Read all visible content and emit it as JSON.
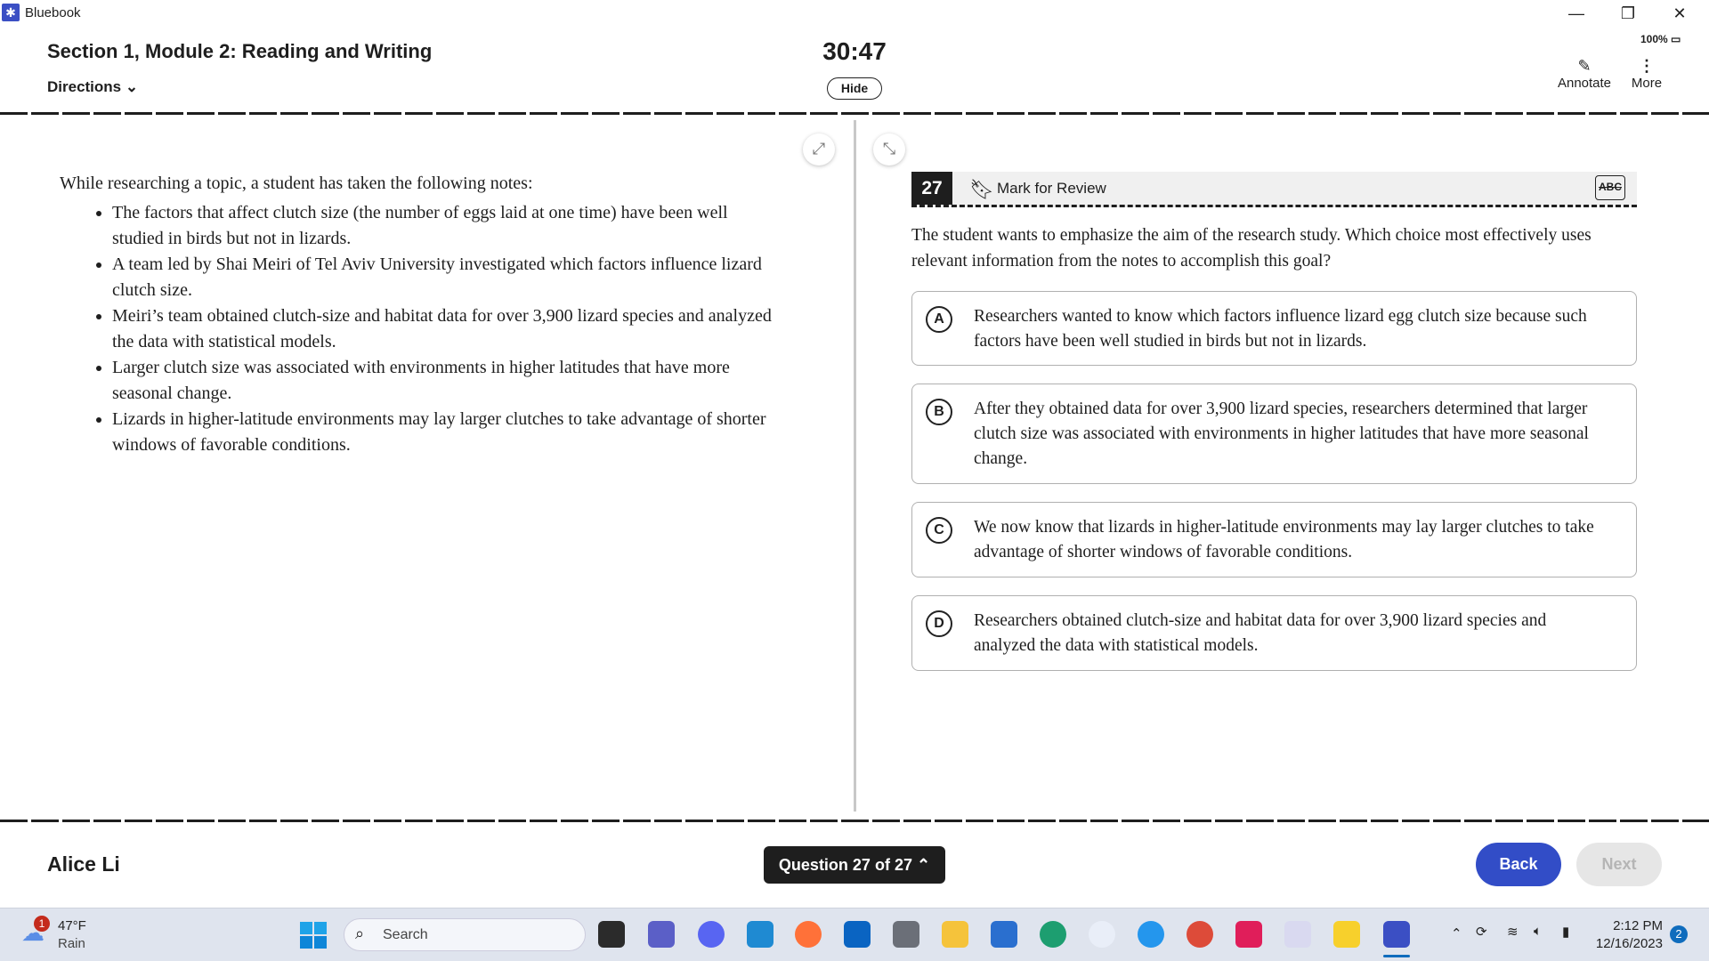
{
  "window": {
    "app_title": "Bluebook",
    "minimize": "—",
    "restore": "❐",
    "close": "✕"
  },
  "header": {
    "section_title": "Section 1, Module 2: Reading and Writing",
    "directions_label": "Directions",
    "timer": "30:47",
    "hide_label": "Hide",
    "battery": "100%",
    "annotate_label": "Annotate",
    "more_label": "More"
  },
  "passage": {
    "intro": "While researching a topic, a student has taken the following notes:",
    "bullets": [
      "The factors that affect clutch size (the number of eggs laid at one time) have been well studied in birds but not in lizards.",
      "A team led by Shai Meiri of Tel Aviv University investigated which factors influence lizard clutch size.",
      "Meiri’s team obtained clutch-size and habitat data for over 3,900 lizard species and analyzed the data with statistical models.",
      "Larger clutch size was associated with environments in higher latitudes that have more seasonal change.",
      "Lizards in higher-latitude environments may lay larger clutches to take advantage of shorter windows of favorable conditions."
    ]
  },
  "question": {
    "number": "27",
    "mark_label": "Mark for Review",
    "prompt": "The student wants to emphasize the aim of the research study. Which choice most effectively uses relevant information from the notes to accomplish this goal?",
    "options": [
      {
        "letter": "A",
        "text": "Researchers wanted to know which factors influence lizard egg clutch size because such factors have been well studied in birds but not in lizards."
      },
      {
        "letter": "B",
        "text": "After they obtained data for over 3,900 lizard species, researchers determined that larger clutch size was associated with environments in higher latitudes that have more seasonal change."
      },
      {
        "letter": "C",
        "text": "We now know that lizards in higher-latitude environments may lay larger clutches to take advantage of shorter windows of favorable conditions."
      },
      {
        "letter": "D",
        "text": "Researchers obtained clutch-size and habitat data for over 3,900 lizard species and analyzed the data with statistical models."
      }
    ]
  },
  "footer": {
    "student_name": "Alice Li",
    "question_nav": "Question 27 of 27",
    "back_label": "Back",
    "next_label": "Next"
  },
  "taskbar": {
    "weather_temp": "47°F",
    "weather_cond": "Rain",
    "weather_badge": "1",
    "search_placeholder": "Search",
    "time": "2:12 PM",
    "date": "12/16/2023",
    "notif_count": "2"
  },
  "colors": {
    "accent": "#324dc7",
    "dark": "#1e1e1e"
  }
}
